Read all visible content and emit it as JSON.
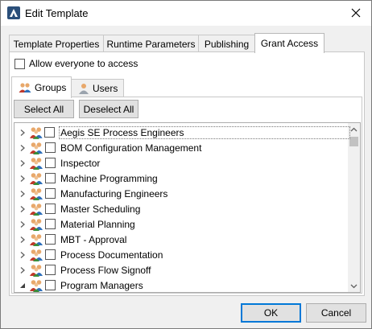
{
  "window": {
    "title": "Edit Template"
  },
  "tabs": [
    {
      "label": "Template Properties"
    },
    {
      "label": "Runtime Parameters"
    },
    {
      "label": "Publishing"
    },
    {
      "label": "Grant Access"
    }
  ],
  "grant_access": {
    "allow_everyone_label": "Allow everyone to access",
    "allow_everyone_checked": false,
    "subtabs": [
      {
        "label": "Groups"
      },
      {
        "label": "Users"
      }
    ],
    "select_all_label": "Select All",
    "deselect_all_label": "Deselect All",
    "groups": [
      {
        "label": "Aegis SE Process Engineers"
      },
      {
        "label": "BOM Configuration Management"
      },
      {
        "label": "Inspector"
      },
      {
        "label": "Machine Programming"
      },
      {
        "label": "Manufacturing Engineers"
      },
      {
        "label": "Master Scheduling"
      },
      {
        "label": "Material Planning"
      },
      {
        "label": "MBT - Approval"
      },
      {
        "label": "Process Documentation"
      },
      {
        "label": "Process Flow Signoff"
      },
      {
        "label": "Program Managers"
      }
    ]
  },
  "footer": {
    "ok_label": "OK",
    "cancel_label": "Cancel"
  },
  "colors": {
    "accent": "#0078d7",
    "window_bg": "#f0f0f0"
  }
}
